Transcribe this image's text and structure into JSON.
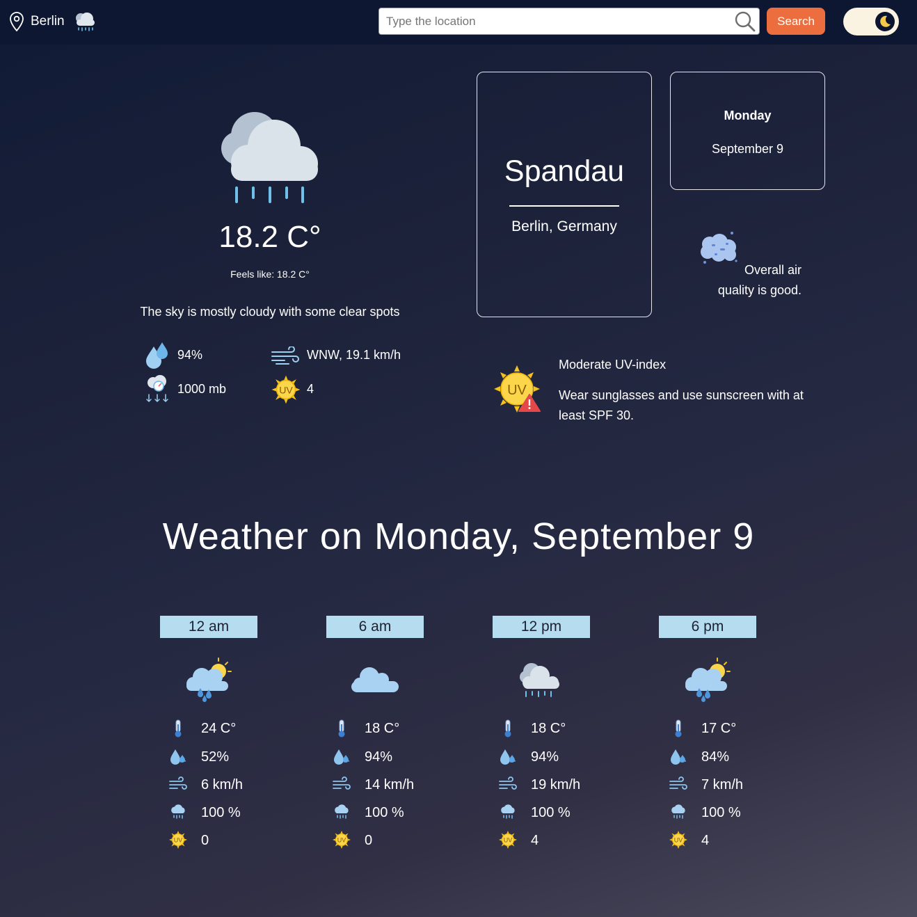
{
  "header": {
    "location_label": "Berlin",
    "search_placeholder": "Type the location",
    "search_label": "Search"
  },
  "current": {
    "temperature": "18.2 C°",
    "feels_like": "Feels like: 18.2 C°",
    "description": "The sky is mostly cloudy with some clear spots",
    "humidity": "94%",
    "wind": "WNW, 19.1 km/h",
    "pressure": "1000 mb",
    "uv": "4"
  },
  "place": {
    "name": "Spandau",
    "region": "Berlin, Germany"
  },
  "date": {
    "day": "Monday",
    "date": "September 9"
  },
  "air_quality": {
    "line1": "Overall air",
    "line2": "quality is good."
  },
  "uv_info": {
    "title": "Moderate UV-index",
    "advice": "Wear sunglasses and use sunscreen with at least SPF 30."
  },
  "forecast": {
    "title": "Weather on Monday, September 9",
    "hours": [
      {
        "time": "12 am",
        "icon": "rain-sun-icon",
        "temp": "24 C°",
        "humidity": "52%",
        "wind": "6 km/h",
        "precip": "100 %",
        "uv": "0"
      },
      {
        "time": "6 am",
        "icon": "cloud-icon",
        "temp": "18 C°",
        "humidity": "94%",
        "wind": "14 km/h",
        "precip": "100 %",
        "uv": "0"
      },
      {
        "time": "12 pm",
        "icon": "cloud-rain-icon",
        "temp": "18 C°",
        "humidity": "94%",
        "wind": "19 km/h",
        "precip": "100 %",
        "uv": "4"
      },
      {
        "time": "6 pm",
        "icon": "rain-sun-icon",
        "temp": "17 C°",
        "humidity": "84%",
        "wind": "7 km/h",
        "precip": "100 %",
        "uv": "4"
      }
    ]
  },
  "colors": {
    "accent": "#ec6e3e",
    "hour_label_bg": "#b6ddef",
    "toggle_bg": "#faf3e2"
  }
}
